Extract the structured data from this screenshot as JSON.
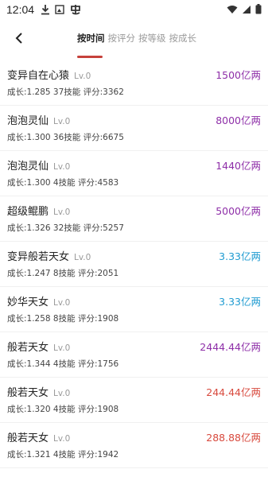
{
  "status": {
    "time": "12:04",
    "notif_icons": [
      "download-icon",
      "picture-icon",
      "app-icon"
    ]
  },
  "header": {
    "tabs": [
      {
        "label": "按时间",
        "active": true
      },
      {
        "label": "按评分",
        "active": false
      },
      {
        "label": "按等级",
        "active": false
      },
      {
        "label": "按成长",
        "active": false
      }
    ]
  },
  "rows": [
    {
      "name": "变异自在心猿",
      "level": "Lv.0",
      "price": "1500亿两",
      "price_color": "purple",
      "meta": "成长:1.285 37技能 评分:3362"
    },
    {
      "name": "泡泡灵仙",
      "level": "Lv.0",
      "price": "8000亿两",
      "price_color": "purple",
      "meta": "成长:1.300 36技能 评分:6675"
    },
    {
      "name": "泡泡灵仙",
      "level": "Lv.0",
      "price": "1440亿两",
      "price_color": "purple",
      "meta": "成长:1.300 4技能 评分:4583"
    },
    {
      "name": "超级鲲鹏",
      "level": "Lv.0",
      "price": "5000亿两",
      "price_color": "purple",
      "meta": "成长:1.326 32技能 评分:5257"
    },
    {
      "name": "变异般若天女",
      "level": "Lv.0",
      "price": "3.33亿两",
      "price_color": "blue",
      "meta": "成长:1.247 8技能 评分:2051"
    },
    {
      "name": "妙华天女",
      "level": "Lv.0",
      "price": "3.33亿两",
      "price_color": "blue",
      "meta": "成长:1.258 8技能 评分:1908"
    },
    {
      "name": "般若天女",
      "level": "Lv.0",
      "price": "2444.44亿两",
      "price_color": "purple",
      "meta": "成长:1.344 4技能 评分:1756"
    },
    {
      "name": "般若天女",
      "level": "Lv.0",
      "price": "244.44亿两",
      "price_color": "red",
      "meta": "成长:1.320 4技能 评分:1908"
    },
    {
      "name": "般若天女",
      "level": "Lv.0",
      "price": "288.88亿两",
      "price_color": "red",
      "meta": "成长:1.321 4技能 评分:1942"
    }
  ],
  "colors": {
    "purple": "#8e2fa8",
    "blue": "#1f9bd1",
    "red": "#d84a3e",
    "accent": "#c6413b"
  }
}
